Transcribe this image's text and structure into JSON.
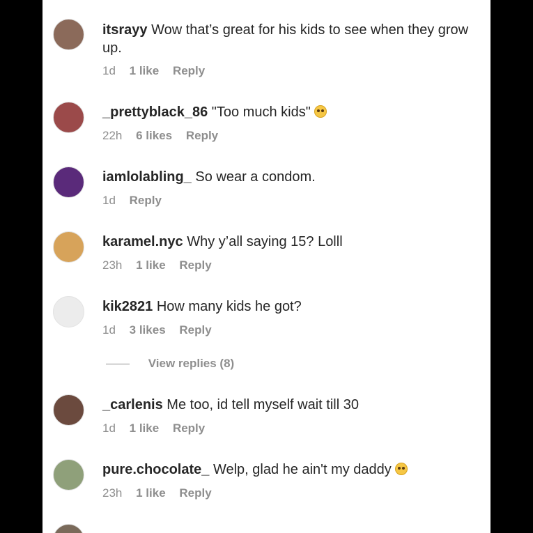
{
  "comments": [
    {
      "user": "itsrayy",
      "text": "Wow that’s great for his kids to see when they grow up.",
      "time": "1d",
      "likes": "1 like",
      "reply": "Reply",
      "avatar": "#8b6a5a"
    },
    {
      "user": "_prettyblack_86",
      "text": "\"Too much kids\"",
      "time": "22h",
      "likes": "6 likes",
      "reply": "Reply",
      "avatar": "#9b4a4a"
    },
    {
      "user": "iamlolabling_",
      "text": "So wear a condom.",
      "time": "1d",
      "likes": "",
      "reply": "Reply",
      "avatar": "#5a2a7a"
    },
    {
      "user": "karamel.nyc",
      "text": "Why y’all saying 15? Lolll",
      "time": "23h",
      "likes": "1 like",
      "reply": "Reply",
      "avatar": "#d7a35a"
    },
    {
      "user": "kik2821",
      "text": "How many kids he got?",
      "time": "1d",
      "likes": "3 likes",
      "reply": "Reply",
      "avatar": "#ececec"
    },
    {
      "user": "_carlenis",
      "text": "Me too, id tell myself wait till 30",
      "time": "1d",
      "likes": "1 like",
      "reply": "Reply",
      "avatar": "#6b4a3e"
    },
    {
      "user": "pure.chocolate_",
      "text": "Welp, glad he ain't my daddy",
      "time": "23h",
      "likes": "1 like",
      "reply": "Reply",
      "avatar": "#8fa07a"
    }
  ],
  "view_replies": "View replies (8)"
}
